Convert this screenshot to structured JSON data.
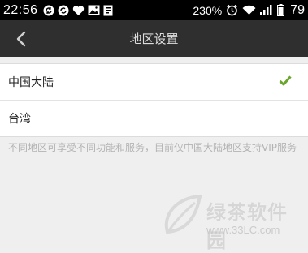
{
  "status_bar": {
    "time": "22:56",
    "battery_percent": "230",
    "percent_sign": "%",
    "signal_text": "ııll",
    "battery_level": "79"
  },
  "title_bar": {
    "title": "地区设置",
    "back_icon": "chevron-left-icon"
  },
  "regions": [
    {
      "label": "中国大陆",
      "selected": true
    },
    {
      "label": "台湾",
      "selected": false
    }
  ],
  "description": "不同地区可享受不同功能和服务，目前仅中国大陆地区支持VIP服务",
  "watermark": {
    "name": "绿茶软件园",
    "url": "www.33LC.com"
  },
  "colors": {
    "status_bar_bg": "#000000",
    "title_bar_bg": "#2f2f2f",
    "check_green": "#6aa52c",
    "page_bg": "#efefef"
  }
}
